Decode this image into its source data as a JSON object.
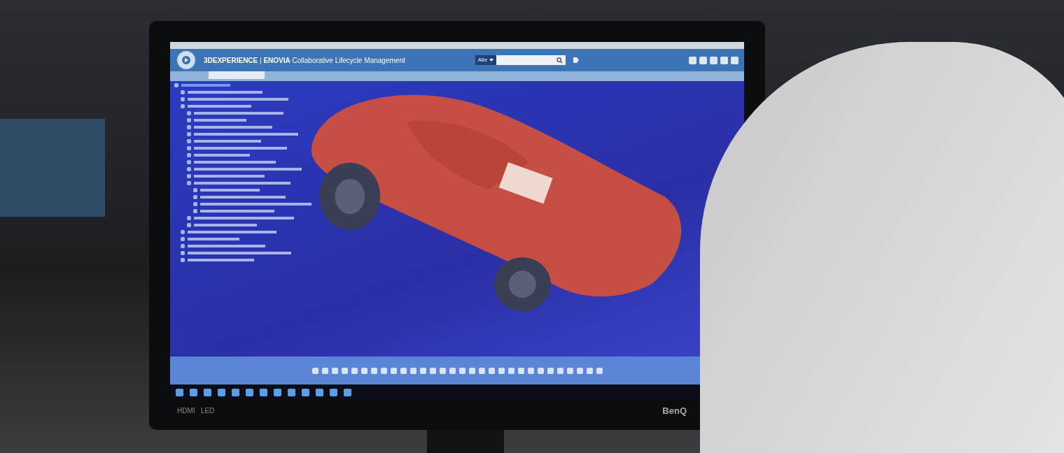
{
  "app": {
    "brand": "3DEXPERIENCE",
    "separator": "|",
    "product": "ENOVIA",
    "title": "Collaborative Lifecycle Management",
    "search": {
      "scope": "Alle"
    }
  },
  "monitor": {
    "brand": "BenQ",
    "ports": [
      "HDMI",
      "LED"
    ]
  }
}
